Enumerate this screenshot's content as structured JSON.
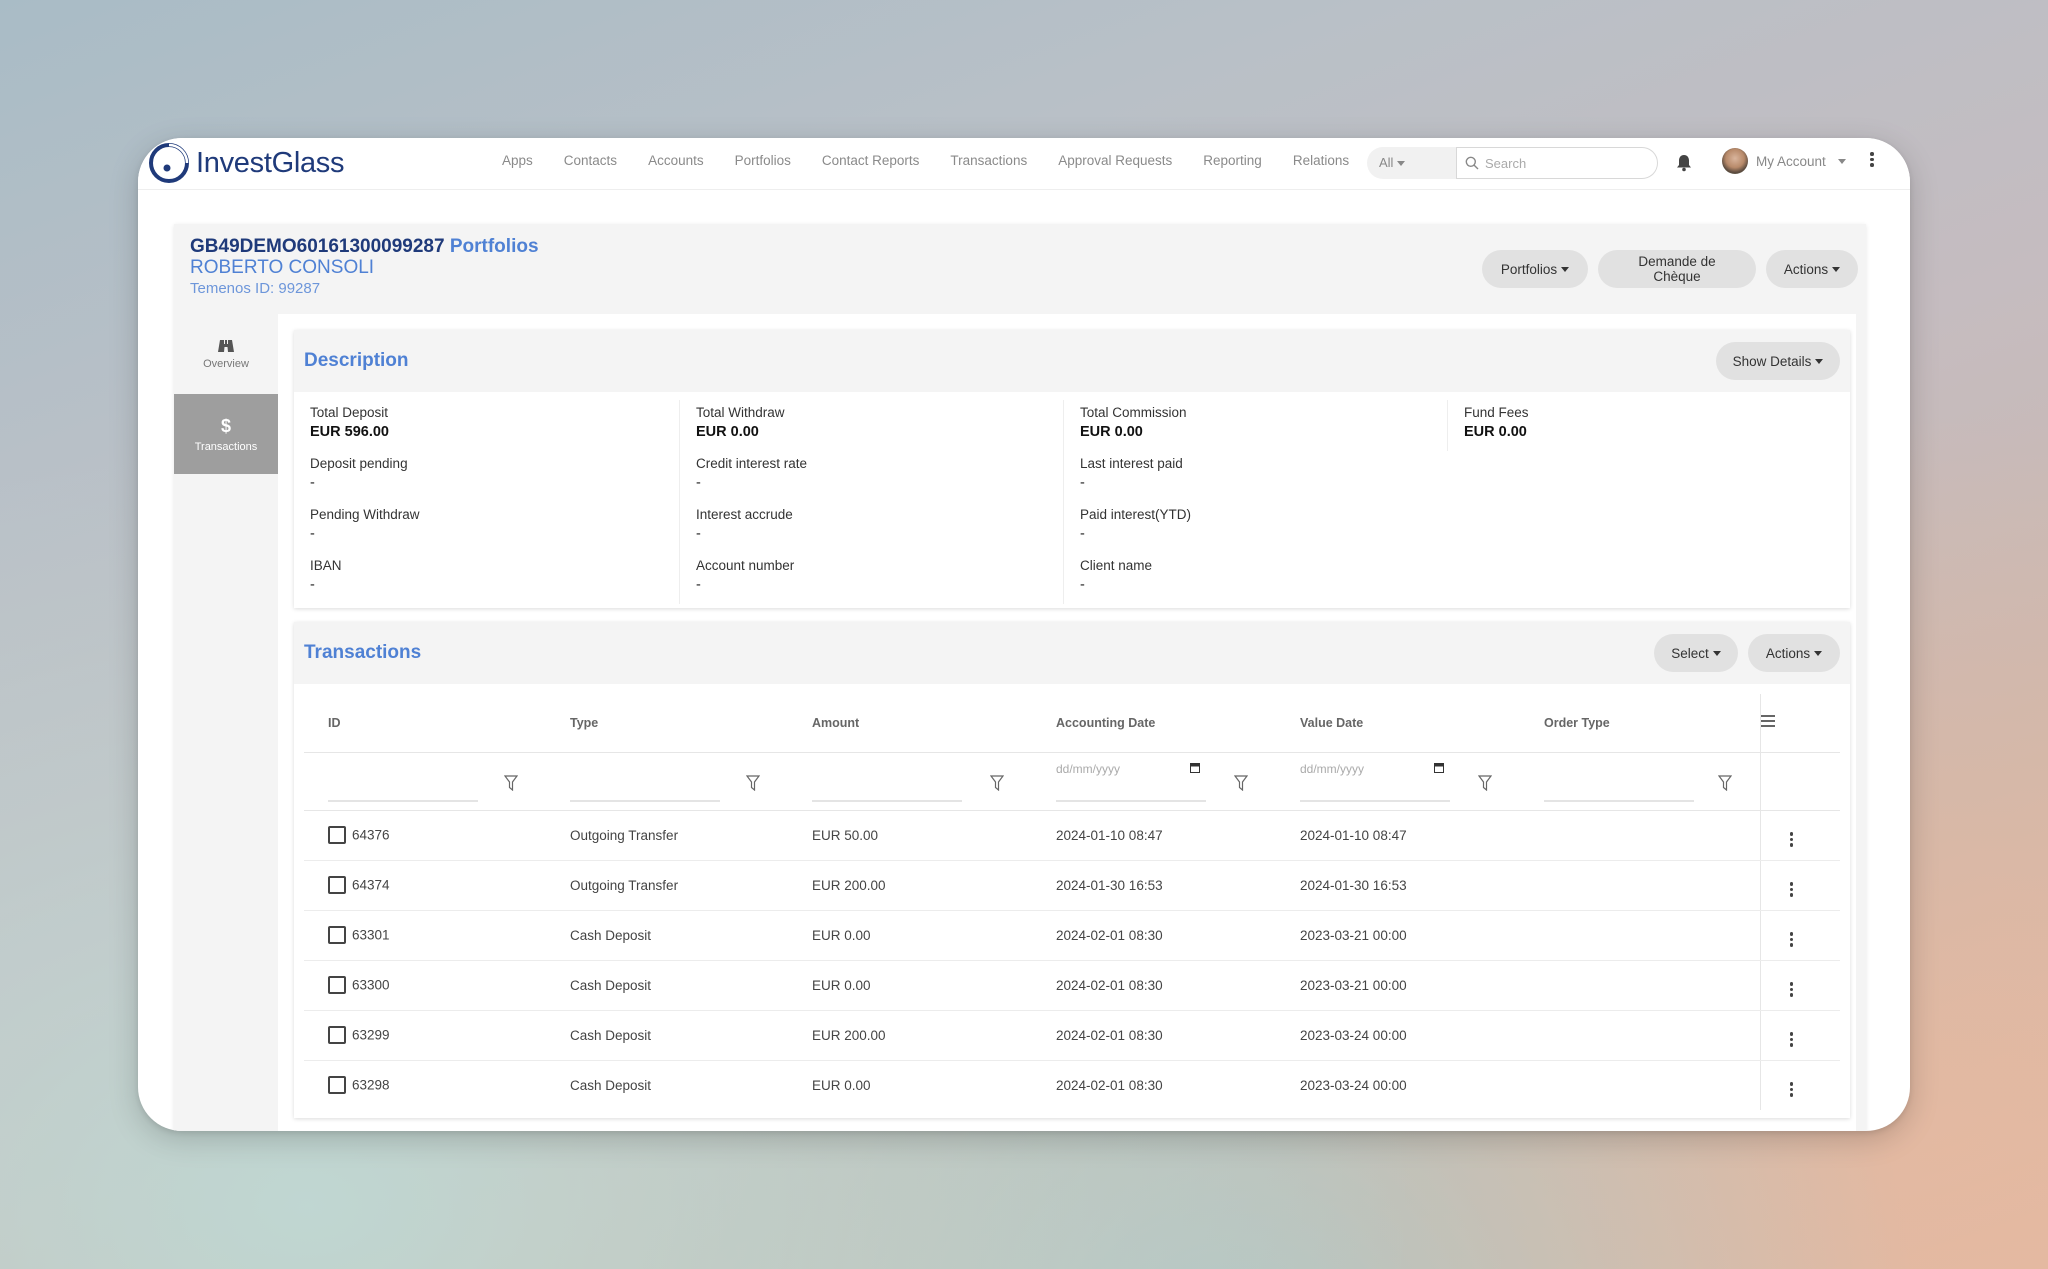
{
  "app": {
    "brand": "InvestGlass",
    "nav": [
      "Apps",
      "Contacts",
      "Accounts",
      "Portfolios",
      "Contact Reports",
      "Transactions",
      "Approval Requests",
      "Reporting",
      "Relations"
    ],
    "scope_select": "All",
    "search_placeholder": "Search",
    "account_label": "My Account"
  },
  "header": {
    "account_id": "GB49DEMO60161300099287",
    "account_suffix": "Portfolios",
    "client_name": "ROBERTO CONSOLI",
    "temenos_id": "Temenos ID: 99287",
    "buttons": {
      "portfolios": "Portfolios",
      "cheque": "Demande de Chèque",
      "actions": "Actions"
    }
  },
  "sidebar": {
    "items": [
      {
        "label": "Overview",
        "icon": "binoculars-icon",
        "active": false
      },
      {
        "label": "Transactions",
        "icon": "dollar-icon",
        "active": true
      }
    ]
  },
  "description": {
    "title": "Description",
    "show_details": "Show Details",
    "columns": [
      [
        {
          "label": "Total Deposit",
          "value": "EUR 596.00",
          "bold": true
        },
        {
          "label": "Deposit pending",
          "value": "-"
        },
        {
          "label": "Pending Withdraw",
          "value": "-"
        },
        {
          "label": "IBAN",
          "value": "-"
        }
      ],
      [
        {
          "label": "Total Withdraw",
          "value": "EUR 0.00",
          "bold": true
        },
        {
          "label": "Credit interest rate",
          "value": "-"
        },
        {
          "label": "Interest accrude",
          "value": "-"
        },
        {
          "label": "Account number",
          "value": "-"
        }
      ],
      [
        {
          "label": "Total Commission",
          "value": "EUR 0.00",
          "bold": true
        },
        {
          "label": "Last interest paid",
          "value": "-"
        },
        {
          "label": "Paid interest(YTD)",
          "value": "-"
        },
        {
          "label": "Client name",
          "value": "-"
        }
      ],
      [
        {
          "label": "Fund Fees",
          "value": "EUR 0.00",
          "bold": true
        }
      ]
    ]
  },
  "transactions": {
    "title": "Transactions",
    "select_label": "Select",
    "actions_label": "Actions",
    "columns": [
      "ID",
      "Type",
      "Amount",
      "Accounting Date",
      "Value Date",
      "Order Type"
    ],
    "date_placeholder": "dd/mm/yyyy",
    "rows": [
      {
        "id": "64376",
        "type": "Outgoing Transfer",
        "amount": "EUR 50.00",
        "accounting_date": "2024-01-10 08:47",
        "value_date": "2024-01-10 08:47",
        "order_type": ""
      },
      {
        "id": "64374",
        "type": "Outgoing Transfer",
        "amount": "EUR 200.00",
        "accounting_date": "2024-01-30 16:53",
        "value_date": "2024-01-30 16:53",
        "order_type": ""
      },
      {
        "id": "63301",
        "type": "Cash Deposit",
        "amount": "EUR 0.00",
        "accounting_date": "2024-02-01 08:30",
        "value_date": "2023-03-21 00:00",
        "order_type": ""
      },
      {
        "id": "63300",
        "type": "Cash Deposit",
        "amount": "EUR 0.00",
        "accounting_date": "2024-02-01 08:30",
        "value_date": "2023-03-21 00:00",
        "order_type": ""
      },
      {
        "id": "63299",
        "type": "Cash Deposit",
        "amount": "EUR 200.00",
        "accounting_date": "2024-02-01 08:30",
        "value_date": "2023-03-24 00:00",
        "order_type": ""
      },
      {
        "id": "63298",
        "type": "Cash Deposit",
        "amount": "EUR 0.00",
        "accounting_date": "2024-02-01 08:30",
        "value_date": "2023-03-24 00:00",
        "order_type": ""
      }
    ]
  },
  "colors": {
    "brand_navy": "#1f3a7a",
    "accent_blue": "#4f81d4",
    "active_sidebar": "#9e9e9e"
  }
}
